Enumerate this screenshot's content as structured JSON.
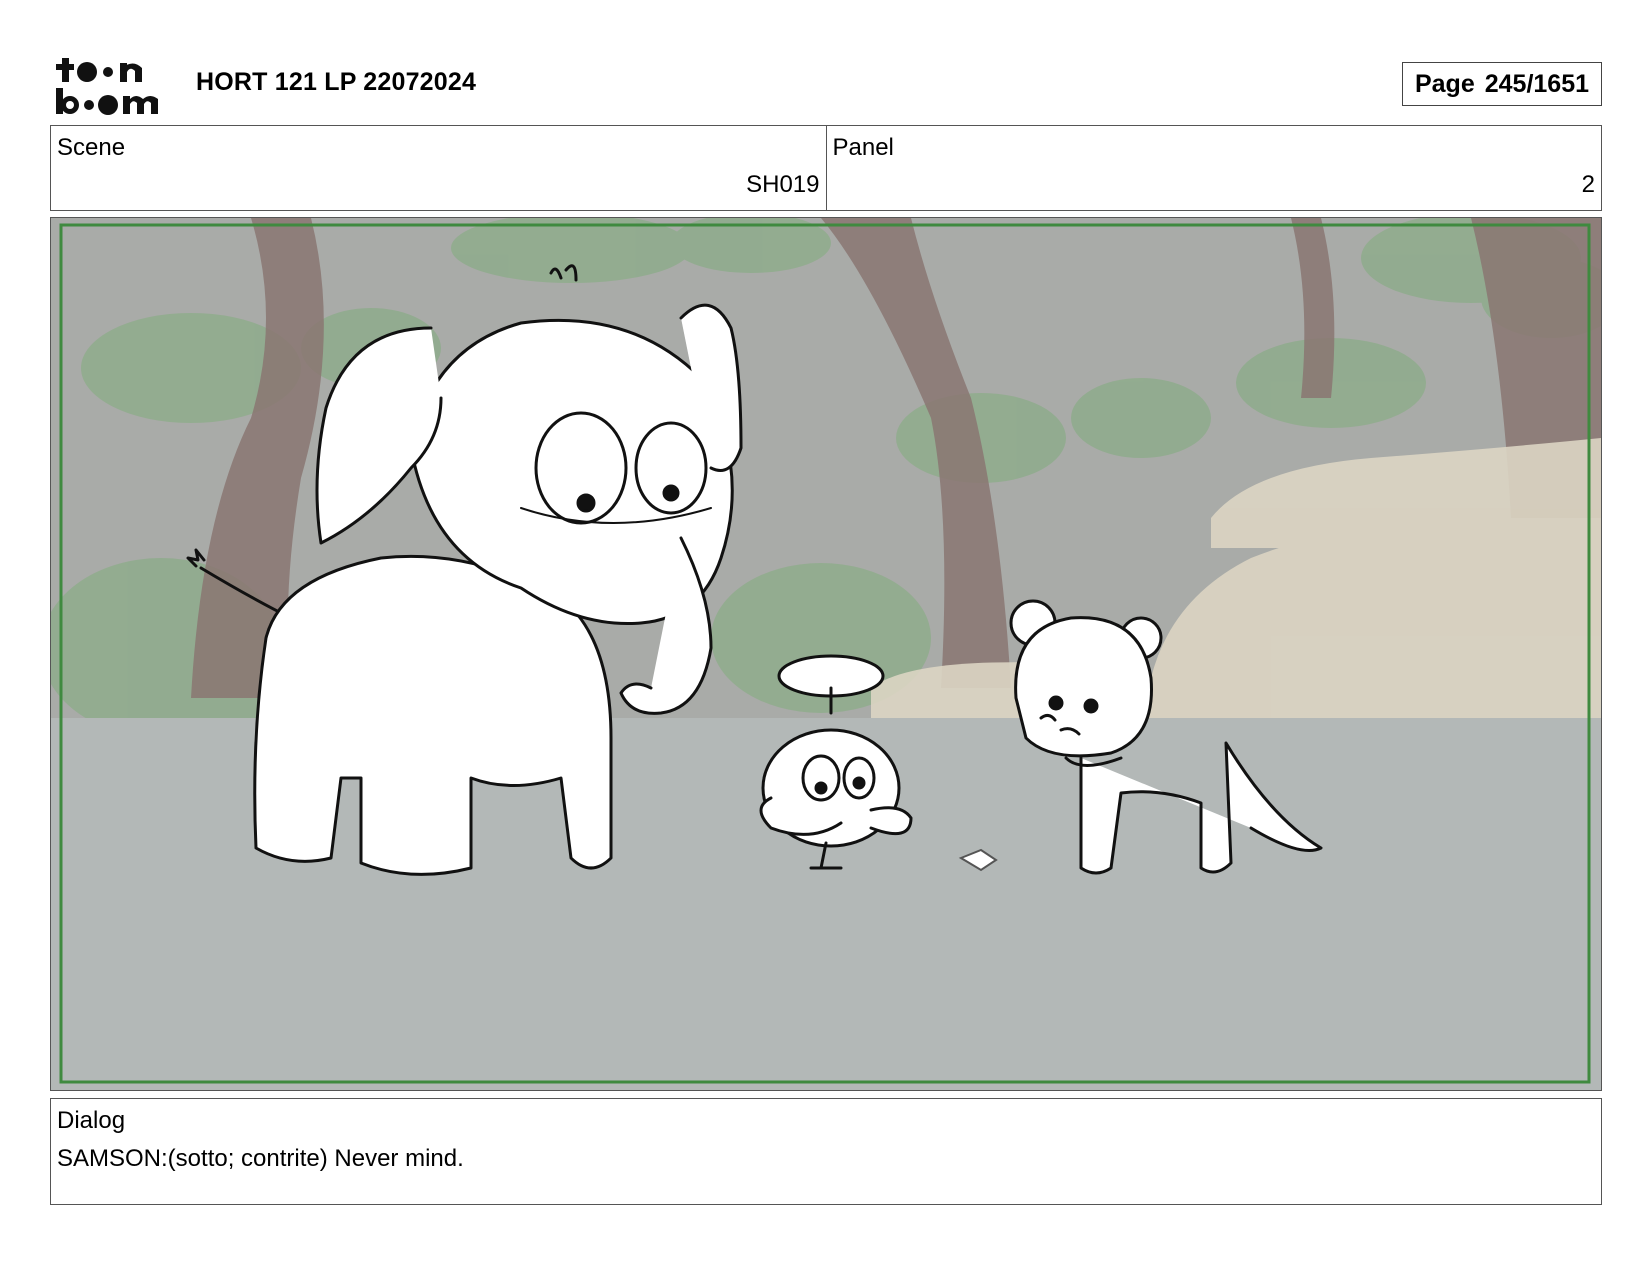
{
  "header": {
    "brand_top": "toon",
    "brand_bottom": "boom",
    "doc_title": "HORT 121 LP 22072024",
    "page_label": "Page",
    "page_number": "245/1651"
  },
  "info": {
    "scene_label": "Scene",
    "scene_value": "SH019",
    "panel_label": "Panel",
    "panel_value": "2"
  },
  "dialog": {
    "label": "Dialog",
    "text": "SAMSON:(sotto; contrite) Never mind."
  },
  "colors": {
    "safe_frame": "#3f8a3f",
    "background_gray": "#a9aba8",
    "ground_gray": "#b3b8b7",
    "foliage_green": "#8fac8c",
    "trunk_brown": "#8a7672",
    "rock_tan": "#dcd5c3"
  }
}
